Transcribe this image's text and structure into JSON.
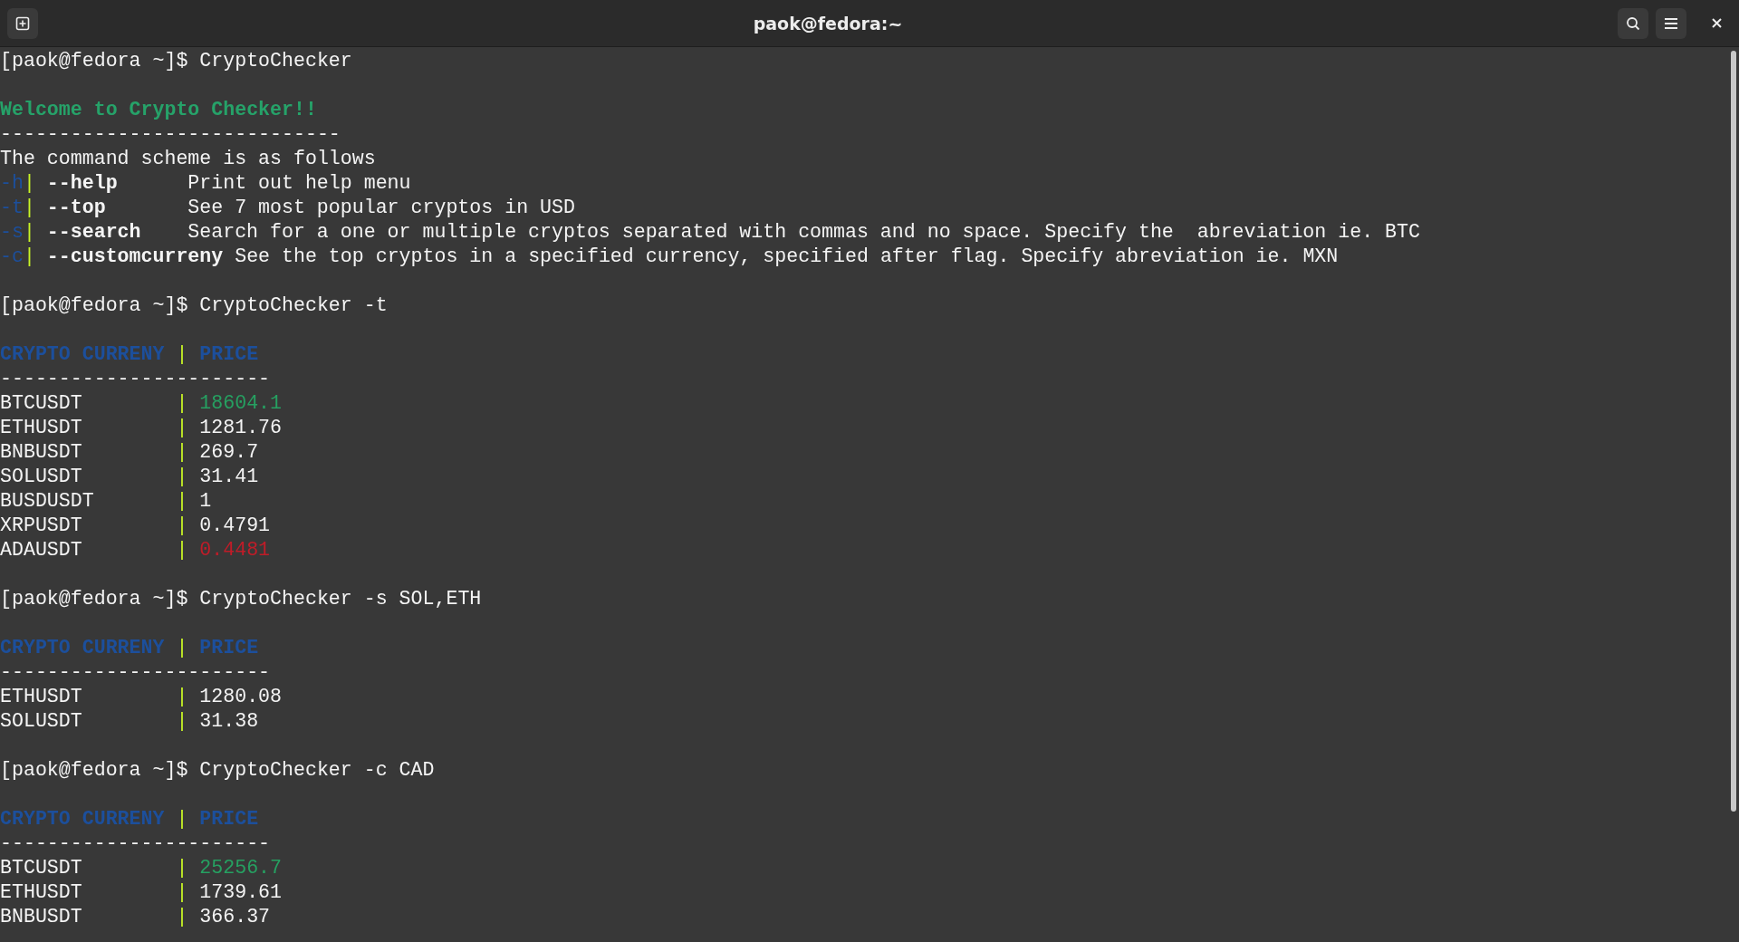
{
  "window": {
    "title": "paok@fedora:~"
  },
  "lines": [
    {
      "kind": "prompt",
      "prompt": "[paok@fedora ~]$",
      "command": "CryptoChecker"
    },
    {
      "kind": "blank"
    },
    {
      "kind": "welcome",
      "text": "Welcome to Crypto Checker!!"
    },
    {
      "kind": "rule",
      "text": "-----------------------------"
    },
    {
      "kind": "text",
      "text": "The command scheme is as follows"
    },
    {
      "kind": "option",
      "short": "-h",
      "separator": "|",
      "long": "--help",
      "description": "Print out help menu"
    },
    {
      "kind": "option",
      "short": "-t",
      "separator": "|",
      "long": "--top",
      "description": "See 7 most popular cryptos in USD"
    },
    {
      "kind": "option",
      "short": "-s",
      "separator": "|",
      "long": "--search",
      "description": "Search for a one or multiple cryptos separated with commas and no space. Specify the  abreviation ie. BTC"
    },
    {
      "kind": "option",
      "short": "-c",
      "separator": "|",
      "long": "--customcurreny",
      "description": "See the top cryptos in a specified currency, specified after flag. Specify abreviation ie. MXN"
    },
    {
      "kind": "blank"
    },
    {
      "kind": "prompt",
      "prompt": "[paok@fedora ~]$",
      "command": "CryptoChecker -t"
    },
    {
      "kind": "blank"
    },
    {
      "kind": "table_header",
      "name": "CRYPTO CURRENY",
      "separator": "|",
      "price": "PRICE"
    },
    {
      "kind": "rule",
      "text": "-----------------------"
    },
    {
      "kind": "table_row",
      "name": "BTCUSDT",
      "separator": "|",
      "price": "18604.1",
      "color": "#26a061"
    },
    {
      "kind": "table_row",
      "name": "ETHUSDT",
      "separator": "|",
      "price": "1281.76",
      "color": "#f4f4f4"
    },
    {
      "kind": "table_row",
      "name": "BNBUSDT",
      "separator": "|",
      "price": "269.7",
      "color": "#f4f4f4"
    },
    {
      "kind": "table_row",
      "name": "SOLUSDT",
      "separator": "|",
      "price": "31.41",
      "color": "#f4f4f4"
    },
    {
      "kind": "table_row",
      "name": "BUSDUSDT",
      "separator": "|",
      "price": "1",
      "color": "#f4f4f4"
    },
    {
      "kind": "table_row",
      "name": "XRPUSDT",
      "separator": "|",
      "price": "0.4791",
      "color": "#f4f4f4"
    },
    {
      "kind": "table_row",
      "name": "ADAUSDT",
      "separator": "|",
      "price": "0.4481",
      "color": "#c01c28"
    },
    {
      "kind": "blank"
    },
    {
      "kind": "prompt",
      "prompt": "[paok@fedora ~]$",
      "command": "CryptoChecker -s SOL,ETH"
    },
    {
      "kind": "blank"
    },
    {
      "kind": "table_header",
      "name": "CRYPTO CURRENY",
      "separator": "|",
      "price": "PRICE"
    },
    {
      "kind": "rule",
      "text": "-----------------------"
    },
    {
      "kind": "table_row",
      "name": "ETHUSDT",
      "separator": "|",
      "price": "1280.08",
      "color": "#f4f4f4"
    },
    {
      "kind": "table_row",
      "name": "SOLUSDT",
      "separator": "|",
      "price": "31.38",
      "color": "#f4f4f4"
    },
    {
      "kind": "blank"
    },
    {
      "kind": "prompt",
      "prompt": "[paok@fedora ~]$",
      "command": "CryptoChecker -c CAD"
    },
    {
      "kind": "blank"
    },
    {
      "kind": "table_header",
      "name": "CRYPTO CURRENY",
      "separator": "|",
      "price": "PRICE"
    },
    {
      "kind": "rule",
      "text": "-----------------------"
    },
    {
      "kind": "table_row",
      "name": "BTCUSDT",
      "separator": "|",
      "price": "25256.7",
      "color": "#26a061"
    },
    {
      "kind": "table_row",
      "name": "ETHUSDT",
      "separator": "|",
      "price": "1739.61",
      "color": "#f4f4f4"
    },
    {
      "kind": "table_row",
      "name": "BNBUSDT",
      "separator": "|",
      "price": "366.37",
      "color": "#f4f4f4"
    }
  ]
}
